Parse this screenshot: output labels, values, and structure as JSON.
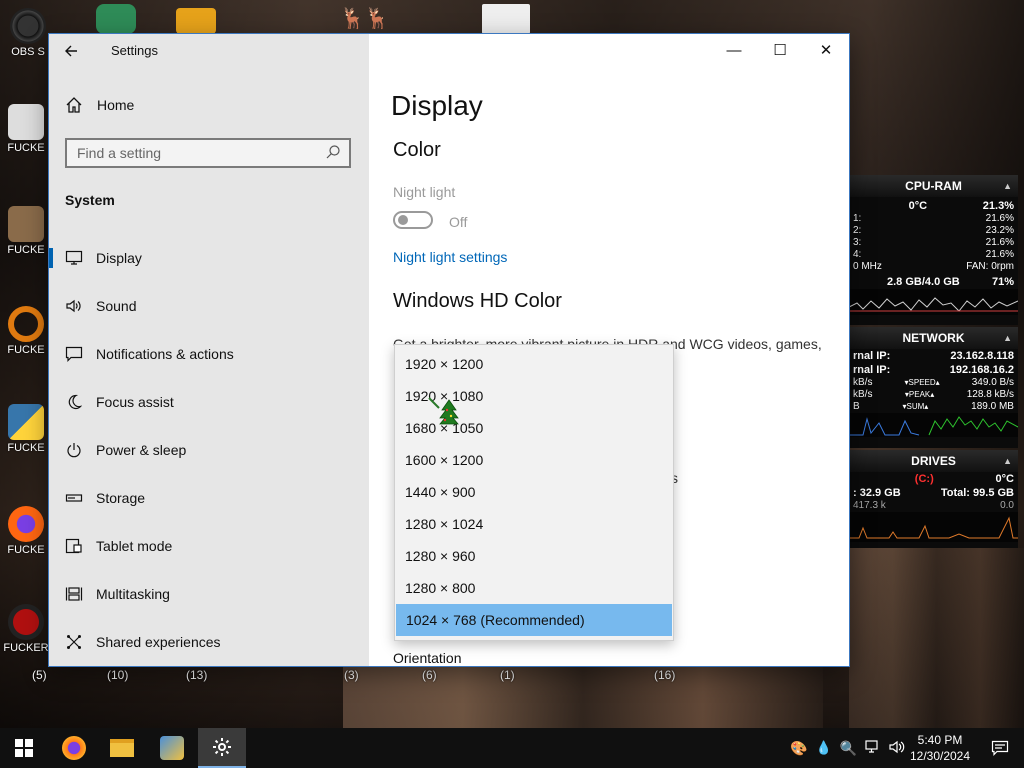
{
  "desktop": {
    "icons": [
      {
        "label": "OBS S",
        "icon": "obs-icon"
      },
      {
        "label": "FUCKE",
        "icon": "folder-icon"
      },
      {
        "label": "FUCKE",
        "icon": "game-icon"
      },
      {
        "label": "FUCKE",
        "icon": "orange-ring-icon"
      },
      {
        "label": "FUCKE",
        "icon": "python-icon"
      },
      {
        "label": "FUCKE",
        "icon": "firefox-icon"
      },
      {
        "label": "FUCKER",
        "icon": "red-circle-icon"
      }
    ],
    "counts": [
      "(5)",
      "(10)",
      "(13)",
      "(3)",
      "(6)",
      "(1)",
      "(16)"
    ]
  },
  "window": {
    "title": "Settings",
    "controls": {
      "minimize": "—",
      "maximize": "☐",
      "close": "✕"
    }
  },
  "sidebar": {
    "home": "Home",
    "search_placeholder": "Find a setting",
    "section": "System",
    "items": [
      {
        "label": "Display",
        "icon": "monitor-icon",
        "active": true
      },
      {
        "label": "Sound",
        "icon": "speaker-icon"
      },
      {
        "label": "Notifications & actions",
        "icon": "notification-icon"
      },
      {
        "label": "Focus assist",
        "icon": "moon-icon"
      },
      {
        "label": "Power & sleep",
        "icon": "power-icon"
      },
      {
        "label": "Storage",
        "icon": "storage-icon"
      },
      {
        "label": "Tablet mode",
        "icon": "tablet-icon"
      },
      {
        "label": "Multitasking",
        "icon": "multitasking-icon"
      },
      {
        "label": "Shared experiences",
        "icon": "share-icon"
      }
    ]
  },
  "main": {
    "title": "Display",
    "color_heading": "Color",
    "night_light_label": "Night light",
    "night_light_state": "Off",
    "night_light_link": "Night light settings",
    "hd_heading": "Windows HD Color",
    "hd_text": "Get a brighter, more vibrant picture in HDR and WCG videos, games,",
    "orientation_label": "Orientation"
  },
  "resolution_dropdown": {
    "options": [
      "1920 × 1200",
      "1920 × 1080",
      "1680 × 1050",
      "1600 × 1200",
      "1440 × 900",
      "1280 × 1024",
      "1280 × 960",
      "1280 × 800",
      "1024 × 768 (Recommended)"
    ],
    "selected_index": 8
  },
  "widgets": {
    "cpu": {
      "title": "CPU-RAM",
      "temp": "0°C",
      "total": "21.3%",
      "cores": [
        {
          "id": "1:",
          "value": "21.6%"
        },
        {
          "id": "2:",
          "value": "23.2%"
        },
        {
          "id": "3:",
          "value": "21.6%"
        },
        {
          "id": "4:",
          "value": "21.6%"
        }
      ],
      "freq": "0 MHz",
      "fan": "FAN: 0rpm",
      "ram": "2.8 GB/4.0 GB",
      "ram_pct": "71%"
    },
    "network": {
      "title": "NETWORK",
      "internal_label": "rnal IP:",
      "internal_ip": "23.162.8.118",
      "external_label": "rnal IP:",
      "external_ip": "192.168.16.2",
      "row1_left": "kB/s",
      "row1_mid": "▾SPEED▴",
      "row1_right": "349.0 B/s",
      "row2_left": "kB/s",
      "row2_mid": "▾PEAK▴",
      "row2_right": "128.8 kB/s",
      "row3_left": "B",
      "row3_mid": "▾SUM▴",
      "row3_right": "189.0 MB"
    },
    "drives": {
      "title": "DRIVES",
      "drive": "(C:)",
      "temp": "0°C",
      "free": ": 32.9 GB",
      "total": "Total: 99.5 GB",
      "io_left": "417.3 k",
      "io_right": "0.0"
    }
  },
  "taskbar": {
    "time": "5:40 PM",
    "date": "12/30/2024",
    "apps": [
      "start-icon",
      "firefox-icon",
      "file-explorer-icon",
      "chat-app-icon",
      "settings-icon"
    ]
  },
  "colors": {
    "accent": "#0063b1",
    "link": "#0067b8",
    "dropdown_selected": "#77b9ee"
  }
}
